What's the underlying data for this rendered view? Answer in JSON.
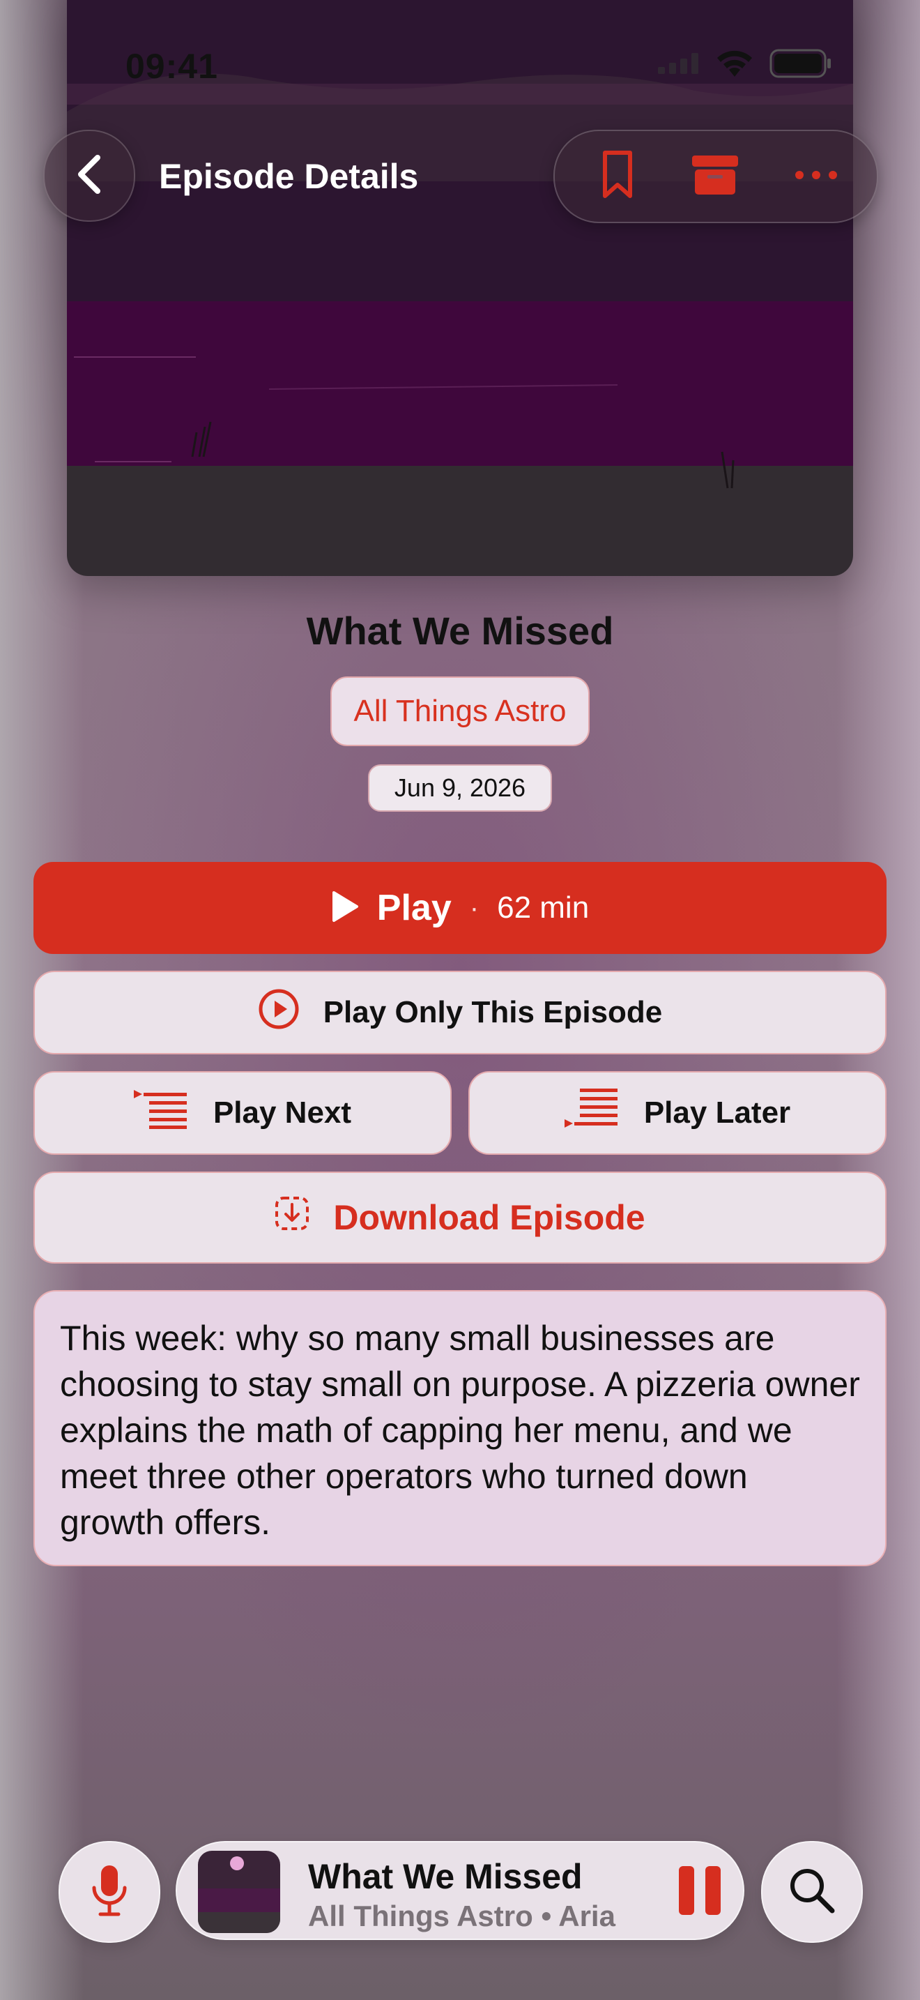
{
  "status_bar": {
    "time": "09:41"
  },
  "nav": {
    "title": "Episode Details"
  },
  "episode": {
    "title": "What We Missed",
    "show": "All Things Astro",
    "date": "Jun 9, 2026"
  },
  "actions": {
    "play_label": "Play",
    "separator": "·",
    "duration": "62 min",
    "play_only": "Play Only This Episode",
    "play_next": "Play Next",
    "play_later": "Play Later",
    "download": "Download Episode"
  },
  "description": "This week: why so many small businesses are choosing to stay small on purpose. A pizzeria owner explains the math of capping her menu, and we meet three other operators who turned down growth offers.",
  "mini_player": {
    "title": "What We Missed",
    "subtitle": "All Things Astro • Aria"
  },
  "icons": {
    "back": "chevron-left-icon",
    "bookmark": "bookmark-icon",
    "archive": "archive-icon",
    "more": "ellipsis-icon",
    "play": "play-icon",
    "play_circle": "play-circle-icon",
    "play_next": "list-insert-top-icon",
    "play_later": "list-insert-bottom-icon",
    "download": "download-icon",
    "mic": "microphone-icon",
    "pause": "pause-icon",
    "search": "search-icon"
  },
  "colors": {
    "accent": "#d62e1f",
    "artwork_sky": "#2c1530",
    "artwork_band": "#3f073c",
    "artwork_ground": "#322c31"
  }
}
